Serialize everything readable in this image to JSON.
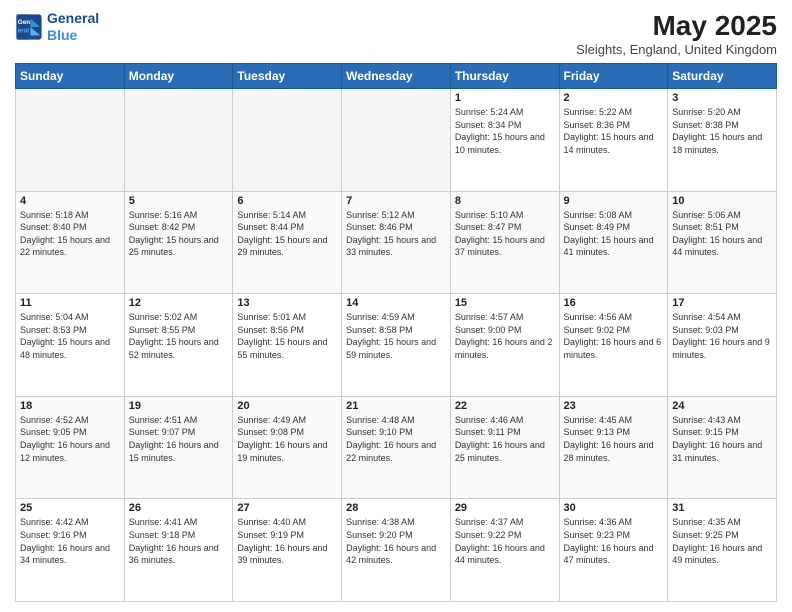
{
  "header": {
    "logo_line1": "General",
    "logo_line2": "Blue",
    "month_year": "May 2025",
    "location": "Sleights, England, United Kingdom"
  },
  "weekdays": [
    "Sunday",
    "Monday",
    "Tuesday",
    "Wednesday",
    "Thursday",
    "Friday",
    "Saturday"
  ],
  "weeks": [
    [
      {
        "day": "",
        "empty": true
      },
      {
        "day": "",
        "empty": true
      },
      {
        "day": "",
        "empty": true
      },
      {
        "day": "",
        "empty": true
      },
      {
        "day": "1",
        "sunrise": "5:24 AM",
        "sunset": "8:34 PM",
        "daylight": "15 hours and 10 minutes."
      },
      {
        "day": "2",
        "sunrise": "5:22 AM",
        "sunset": "8:36 PM",
        "daylight": "15 hours and 14 minutes."
      },
      {
        "day": "3",
        "sunrise": "5:20 AM",
        "sunset": "8:38 PM",
        "daylight": "15 hours and 18 minutes."
      }
    ],
    [
      {
        "day": "4",
        "sunrise": "5:18 AM",
        "sunset": "8:40 PM",
        "daylight": "15 hours and 22 minutes."
      },
      {
        "day": "5",
        "sunrise": "5:16 AM",
        "sunset": "8:42 PM",
        "daylight": "15 hours and 25 minutes."
      },
      {
        "day": "6",
        "sunrise": "5:14 AM",
        "sunset": "8:44 PM",
        "daylight": "15 hours and 29 minutes."
      },
      {
        "day": "7",
        "sunrise": "5:12 AM",
        "sunset": "8:46 PM",
        "daylight": "15 hours and 33 minutes."
      },
      {
        "day": "8",
        "sunrise": "5:10 AM",
        "sunset": "8:47 PM",
        "daylight": "15 hours and 37 minutes."
      },
      {
        "day": "9",
        "sunrise": "5:08 AM",
        "sunset": "8:49 PM",
        "daylight": "15 hours and 41 minutes."
      },
      {
        "day": "10",
        "sunrise": "5:06 AM",
        "sunset": "8:51 PM",
        "daylight": "15 hours and 44 minutes."
      }
    ],
    [
      {
        "day": "11",
        "sunrise": "5:04 AM",
        "sunset": "8:53 PM",
        "daylight": "15 hours and 48 minutes."
      },
      {
        "day": "12",
        "sunrise": "5:02 AM",
        "sunset": "8:55 PM",
        "daylight": "15 hours and 52 minutes."
      },
      {
        "day": "13",
        "sunrise": "5:01 AM",
        "sunset": "8:56 PM",
        "daylight": "15 hours and 55 minutes."
      },
      {
        "day": "14",
        "sunrise": "4:59 AM",
        "sunset": "8:58 PM",
        "daylight": "15 hours and 59 minutes."
      },
      {
        "day": "15",
        "sunrise": "4:57 AM",
        "sunset": "9:00 PM",
        "daylight": "16 hours and 2 minutes."
      },
      {
        "day": "16",
        "sunrise": "4:56 AM",
        "sunset": "9:02 PM",
        "daylight": "16 hours and 6 minutes."
      },
      {
        "day": "17",
        "sunrise": "4:54 AM",
        "sunset": "9:03 PM",
        "daylight": "16 hours and 9 minutes."
      }
    ],
    [
      {
        "day": "18",
        "sunrise": "4:52 AM",
        "sunset": "9:05 PM",
        "daylight": "16 hours and 12 minutes."
      },
      {
        "day": "19",
        "sunrise": "4:51 AM",
        "sunset": "9:07 PM",
        "daylight": "16 hours and 15 minutes."
      },
      {
        "day": "20",
        "sunrise": "4:49 AM",
        "sunset": "9:08 PM",
        "daylight": "16 hours and 19 minutes."
      },
      {
        "day": "21",
        "sunrise": "4:48 AM",
        "sunset": "9:10 PM",
        "daylight": "16 hours and 22 minutes."
      },
      {
        "day": "22",
        "sunrise": "4:46 AM",
        "sunset": "9:11 PM",
        "daylight": "16 hours and 25 minutes."
      },
      {
        "day": "23",
        "sunrise": "4:45 AM",
        "sunset": "9:13 PM",
        "daylight": "16 hours and 28 minutes."
      },
      {
        "day": "24",
        "sunrise": "4:43 AM",
        "sunset": "9:15 PM",
        "daylight": "16 hours and 31 minutes."
      }
    ],
    [
      {
        "day": "25",
        "sunrise": "4:42 AM",
        "sunset": "9:16 PM",
        "daylight": "16 hours and 34 minutes."
      },
      {
        "day": "26",
        "sunrise": "4:41 AM",
        "sunset": "9:18 PM",
        "daylight": "16 hours and 36 minutes."
      },
      {
        "day": "27",
        "sunrise": "4:40 AM",
        "sunset": "9:19 PM",
        "daylight": "16 hours and 39 minutes."
      },
      {
        "day": "28",
        "sunrise": "4:38 AM",
        "sunset": "9:20 PM",
        "daylight": "16 hours and 42 minutes."
      },
      {
        "day": "29",
        "sunrise": "4:37 AM",
        "sunset": "9:22 PM",
        "daylight": "16 hours and 44 minutes."
      },
      {
        "day": "30",
        "sunrise": "4:36 AM",
        "sunset": "9:23 PM",
        "daylight": "16 hours and 47 minutes."
      },
      {
        "day": "31",
        "sunrise": "4:35 AM",
        "sunset": "9:25 PM",
        "daylight": "16 hours and 49 minutes."
      }
    ]
  ]
}
